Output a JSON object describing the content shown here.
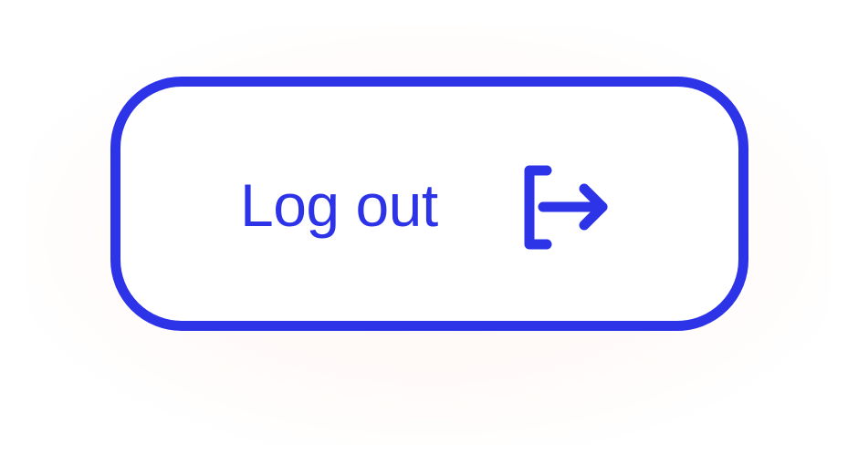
{
  "button": {
    "label": "Log out",
    "icon": "logout-icon",
    "accent_color": "#2d34e8"
  }
}
